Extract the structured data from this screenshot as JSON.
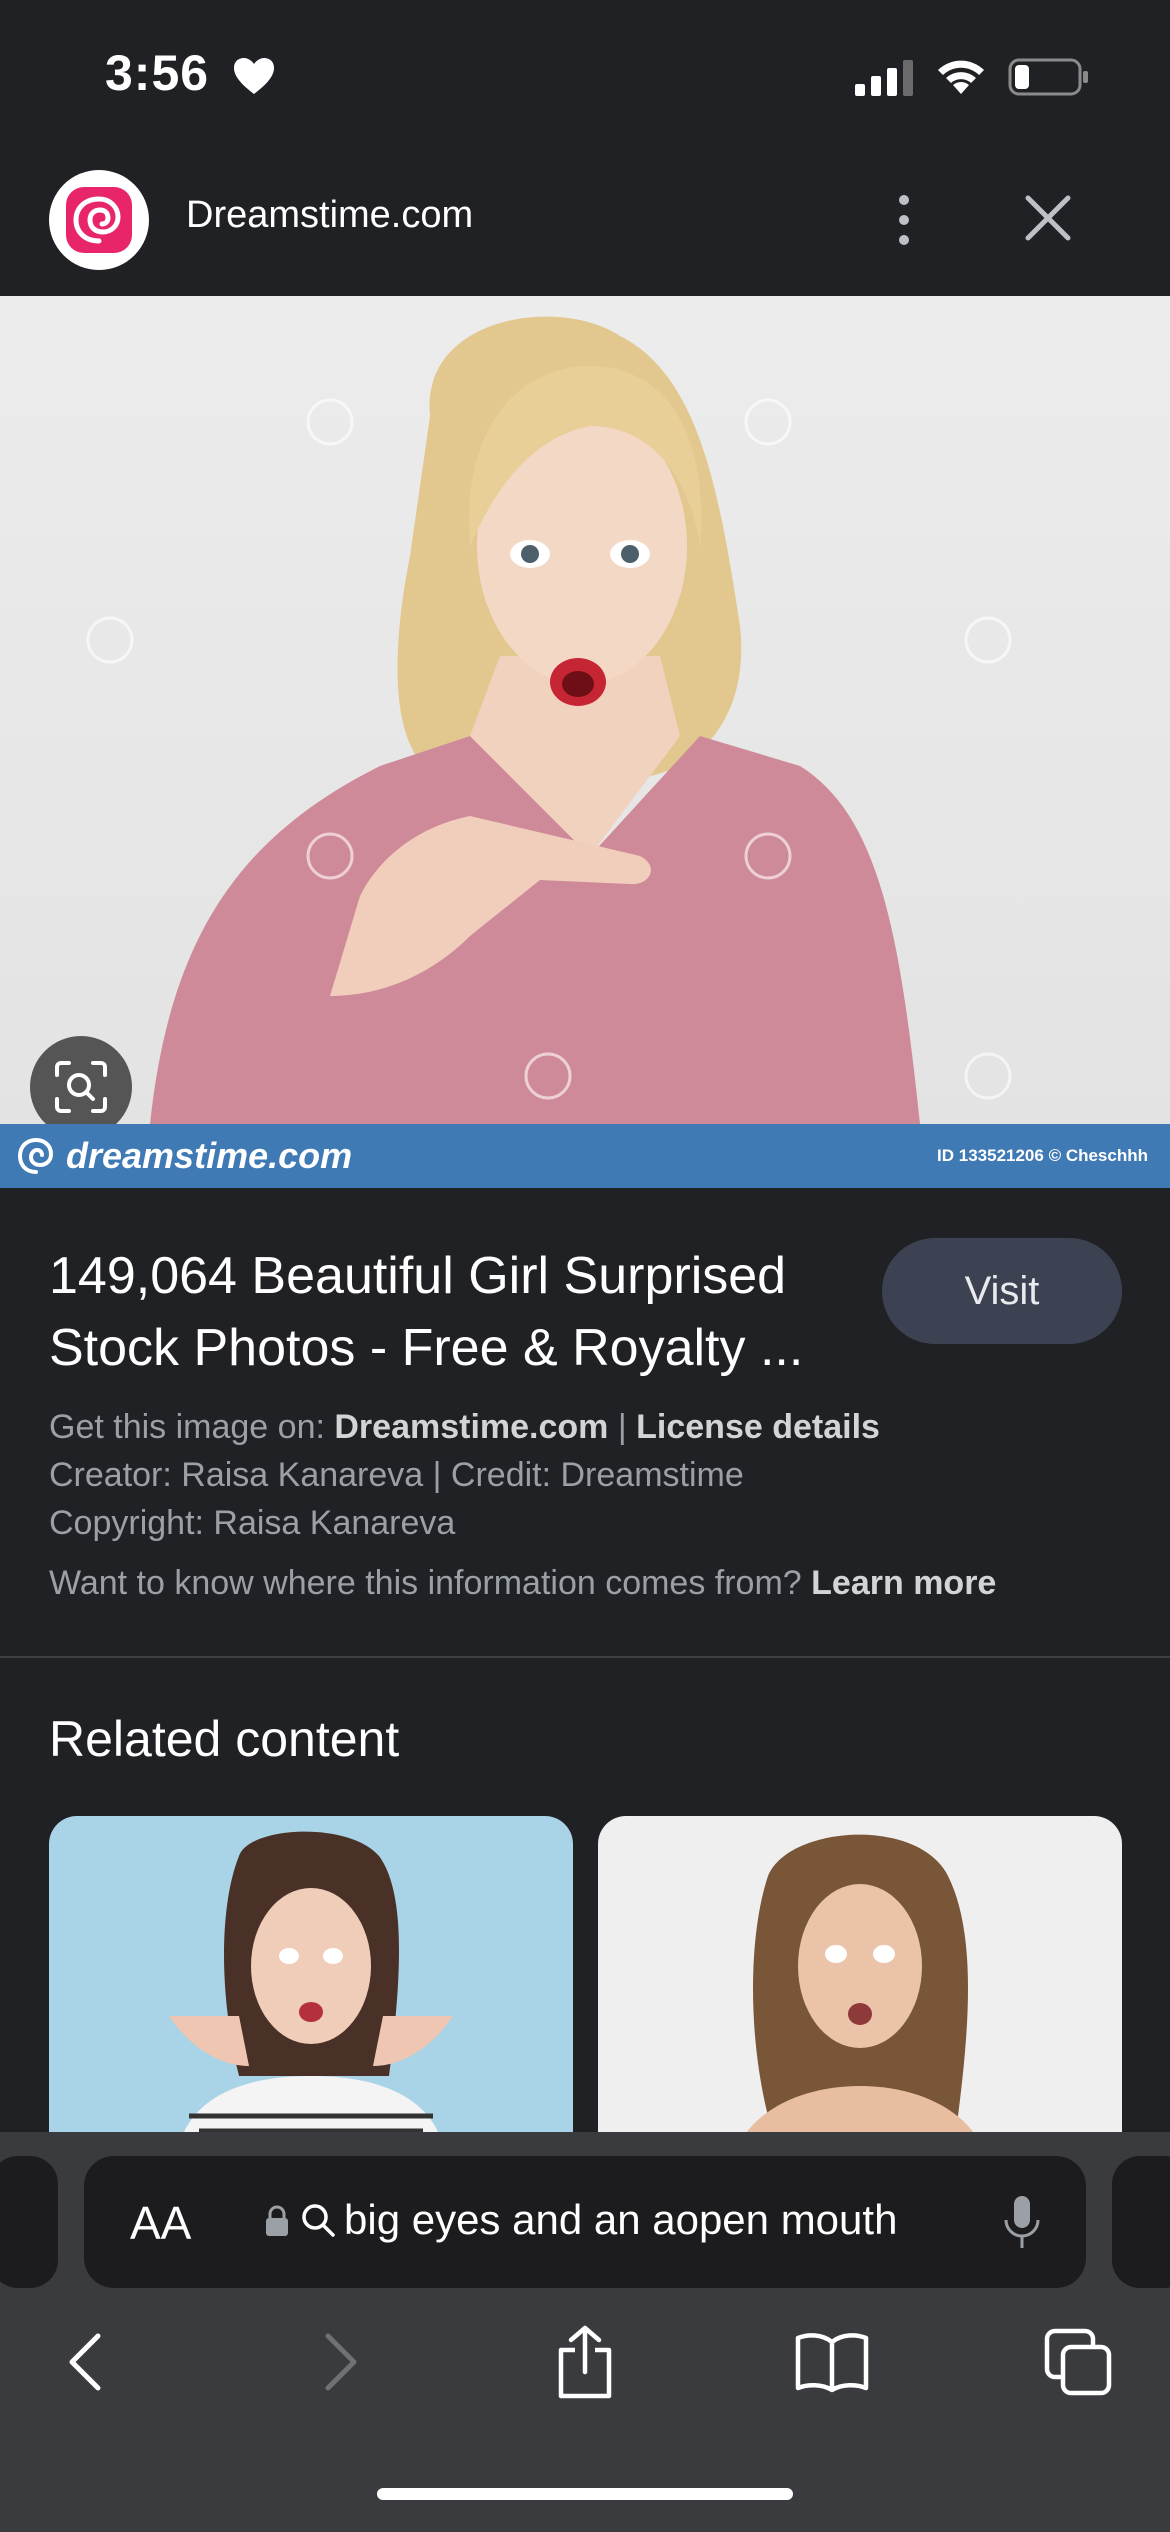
{
  "status": {
    "time": "3:56",
    "icons": [
      "heart-icon",
      "cellular-signal-icon",
      "wifi-icon",
      "battery-icon"
    ]
  },
  "site": {
    "name": "Dreamstime.com",
    "logo_icon": "dreamstime-logo",
    "brand_color": "#e8256b"
  },
  "image": {
    "watermark_brand": "dreamstime.com",
    "watermark_id": "ID 133521206 © Cheschhh",
    "strip_color": "#3f7ab5"
  },
  "result": {
    "title": "149,064 Beautiful Girl Surprised Stock Photos - Free & Royalty ...",
    "visit_label": "Visit",
    "get_image_prefix": "Get this image on:",
    "source_link": "Dreamstime.com",
    "separator": "|",
    "license_link": "License details",
    "creator_credit": "Creator: Raisa Kanareva | Credit: Dreamstime",
    "copyright": "Copyright: Raisa Kanareva",
    "info_question": "Want to know where this information comes from?",
    "learn_more": "Learn more"
  },
  "related": {
    "title": "Related content"
  },
  "browser": {
    "text_size_label": "AA",
    "query": "big eyes and an aopen mouth"
  }
}
